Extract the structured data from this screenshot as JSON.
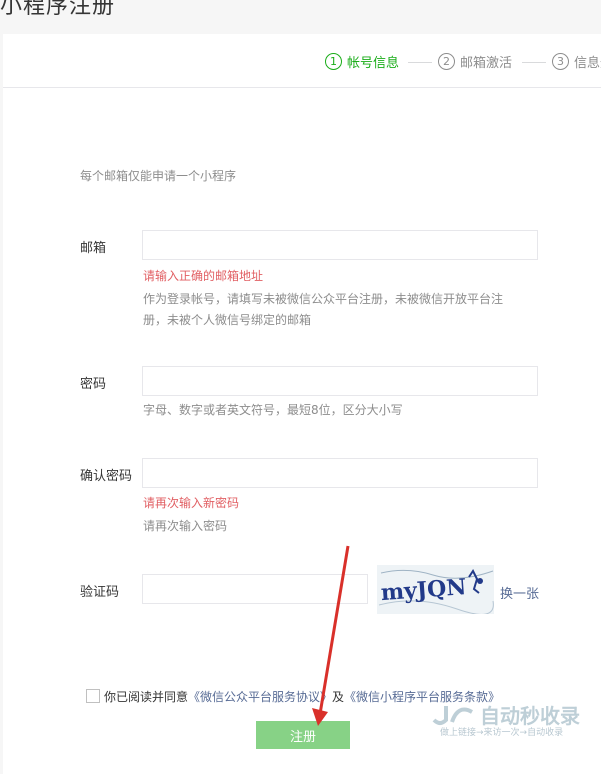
{
  "page_title": "小程序注册",
  "steps": [
    {
      "num": "1",
      "label": "帐号信息"
    },
    {
      "num": "2",
      "label": "邮箱激活"
    },
    {
      "num": "3",
      "label": "信息登记"
    }
  ],
  "intro": "每个邮箱仅能申请一个小程序",
  "email": {
    "label": "邮箱",
    "value": "",
    "error": "请输入正确的邮箱地址",
    "hint_line1": "作为登录帐号，请填写未被微信公众平台注册，未被微信开放平台注",
    "hint_line2": "册，未被个人微信号绑定的邮箱"
  },
  "password": {
    "label": "密码",
    "value": "",
    "hint": "字母、数字或者英文符号，最短8位，区分大小写"
  },
  "confirm": {
    "label": "确认密码",
    "value": "",
    "error": "请再次输入新密码",
    "hint": "请再次输入密码"
  },
  "captcha": {
    "label": "验证码",
    "value": "",
    "image_text": "myJQN",
    "refresh": "换一张"
  },
  "agreement": {
    "prefix": "你已阅读并同意",
    "link1": "《微信公众平台服务协议》",
    "mid": "及",
    "link2": "《微信小程序平台服务条款》"
  },
  "submit": "注册",
  "watermark": {
    "text": "自动秒收录",
    "sub": "做上链接→来访一次→自动收录"
  },
  "colors": {
    "accent": "#1aad19",
    "error": "#e15f63",
    "link": "#576b95",
    "submit_disabled": "#87d286",
    "arrow": "#d9302a"
  }
}
